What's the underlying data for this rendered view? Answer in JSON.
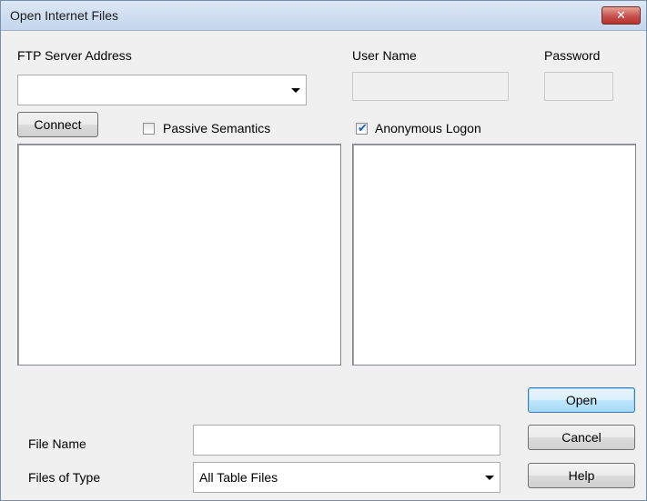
{
  "window": {
    "title": "Open Internet Files",
    "close_symbol": "✕"
  },
  "ftp": {
    "label": "FTP Server Address",
    "value": ""
  },
  "user": {
    "label": "User Name",
    "value": ""
  },
  "password": {
    "label": "Password",
    "value": ""
  },
  "connect_label": "Connect",
  "passive": {
    "label": "Passive Semantics",
    "checked": false
  },
  "anonymous": {
    "label": "Anonymous Logon",
    "checked": true,
    "tick": "✔"
  },
  "file_name": {
    "label": "File Name",
    "value": ""
  },
  "files_of_type": {
    "label": "Files of Type",
    "value": "All Table Files"
  },
  "buttons": {
    "open": "Open",
    "cancel": "Cancel",
    "help": "Help"
  }
}
